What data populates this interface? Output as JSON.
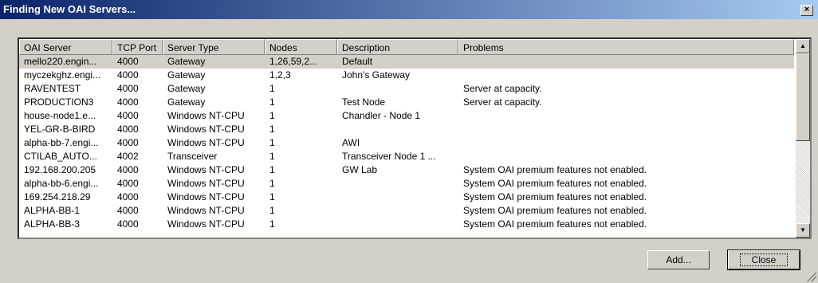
{
  "window": {
    "title": "Finding New OAI Servers...",
    "close_glyph": "×"
  },
  "columns": [
    "OAI Server",
    "TCP Port",
    "Server Type",
    "Nodes",
    "Description",
    "Problems"
  ],
  "rows": [
    [
      "mello220.engin...",
      "4000",
      "Gateway",
      "1,26,59,2...",
      "Default",
      ""
    ],
    [
      "myczekghz.engi...",
      "4000",
      "Gateway",
      "1,2,3",
      "John's Gateway",
      ""
    ],
    [
      "RAVENTEST",
      "4000",
      "Gateway",
      "1",
      "",
      "Server at capacity."
    ],
    [
      "PRODUCTION3",
      "4000",
      "Gateway",
      "1",
      "Test Node",
      "Server at capacity."
    ],
    [
      "house-node1.e...",
      "4000",
      "Windows NT-CPU",
      "1",
      "Chandler - Node 1",
      ""
    ],
    [
      "YEL-GR-B-BIRD",
      "4000",
      "Windows NT-CPU",
      "1",
      "",
      ""
    ],
    [
      "alpha-bb-7.engi...",
      "4000",
      "Windows NT-CPU",
      "1",
      "AWI",
      ""
    ],
    [
      "CTILAB_AUTO...",
      "4002",
      "Transceiver",
      "1",
      "Transceiver Node 1 ...",
      ""
    ],
    [
      "192.168.200.205",
      "4000",
      "Windows NT-CPU",
      "1",
      "GW Lab",
      "System OAI premium features not enabled."
    ],
    [
      "alpha-bb-6.engi...",
      "4000",
      "Windows NT-CPU",
      "1",
      "",
      "System OAI premium features not enabled."
    ],
    [
      "169.254.218.29",
      "4000",
      "Windows NT-CPU",
      "1",
      "",
      "System OAI premium features not enabled."
    ],
    [
      "ALPHA-BB-1",
      "4000",
      "Windows NT-CPU",
      "1",
      "",
      "System OAI premium features not enabled."
    ],
    [
      "ALPHA-BB-3",
      "4000",
      "Windows NT-CPU",
      "1",
      "",
      "System OAI premium features not enabled."
    ]
  ],
  "selected_row": 0,
  "buttons": {
    "add": "Add...",
    "close": "Close"
  },
  "scroll": {
    "up_glyph": "▲",
    "down_glyph": "▼"
  }
}
